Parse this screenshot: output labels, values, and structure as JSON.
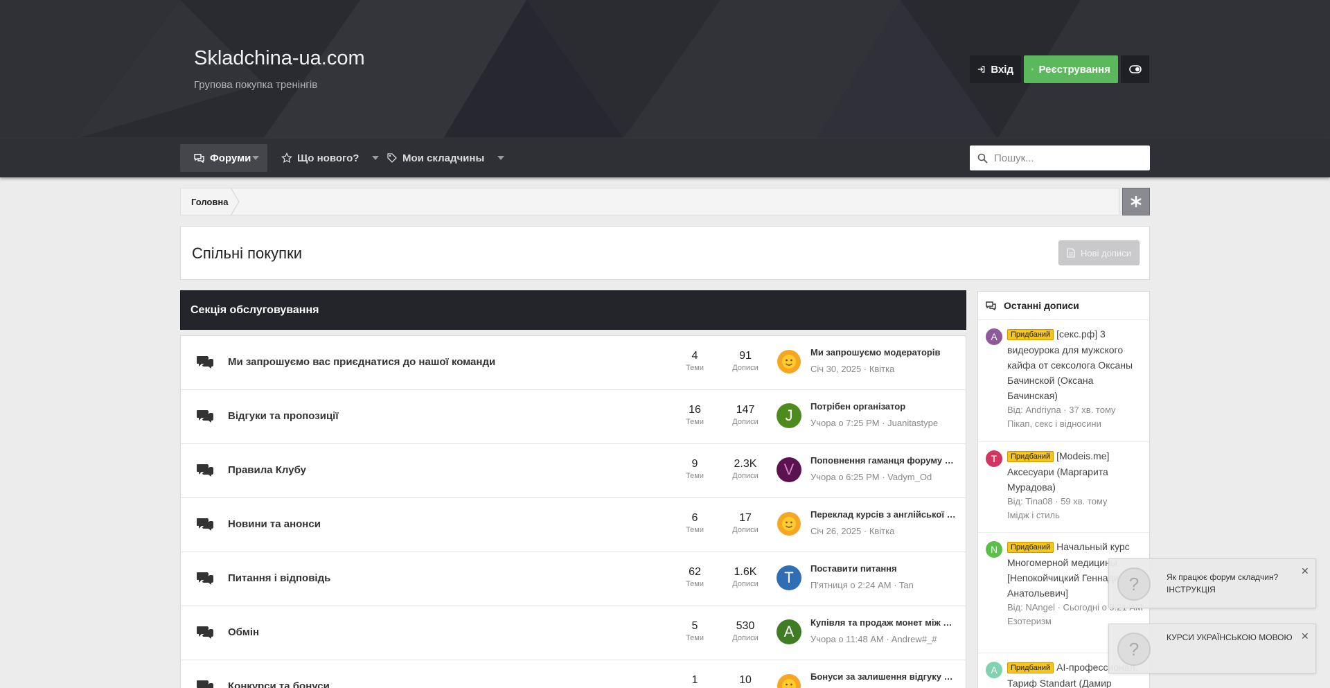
{
  "header": {
    "site_title": "Skladchina-ua.com",
    "site_subtitle": "Групова покупка тренінгів",
    "login_label": "Вхід",
    "register_label": "Реєстрування",
    "register_color": "#5cb85c"
  },
  "nav": {
    "tabs": [
      {
        "label": "Форуми",
        "icon": "comments-icon",
        "active": true
      },
      {
        "label": "Що нового?",
        "icon": "star-icon",
        "active": false
      },
      {
        "label": "Мои складчины",
        "icon": "tag-icon",
        "active": false
      }
    ],
    "search_placeholder": "Пошук..."
  },
  "breadcrumb": {
    "home": "Головна"
  },
  "page": {
    "title": "Спільні покупки",
    "new_posts_label": "Нові дописи"
  },
  "section": {
    "title": "Секція обслуговування"
  },
  "forums": [
    {
      "title": "Ми запрошуємо вас приєднатися до нашої команди",
      "threads": "4",
      "posts": "91",
      "last_title": "Ми запрошуємо модераторів",
      "last_meta": "Січ 30, 2025 · Квітка",
      "avatar": "sun",
      "avatar_letter": "",
      "avatar_color": "#f5a623"
    },
    {
      "title": "Відгуки та пропозиції",
      "threads": "16",
      "posts": "147",
      "last_title": "Потрібен організатор",
      "last_meta": "Учора о 7:25 PM · Juanitastype",
      "avatar": "letter",
      "avatar_letter": "J",
      "avatar_color": "#4f8a1f"
    },
    {
      "title": "Правила Клубу",
      "threads": "9",
      "posts": "2.3K",
      "last_title": "Поповнення гаманця форуму Складчина",
      "last_meta": "Учора о 6:25 PM · Vadym_Od",
      "avatar": "letter",
      "avatar_letter": "V",
      "avatar_color": "#5a1250"
    },
    {
      "title": "Новини та анонси",
      "threads": "6",
      "posts": "17",
      "last_title": "Переклад курсів з англійської мови",
      "last_meta": "Січ 26, 2025 · Квітка",
      "avatar": "sun",
      "avatar_letter": "",
      "avatar_color": "#f5a623"
    },
    {
      "title": "Питання і відповідь",
      "threads": "62",
      "posts": "1.6K",
      "last_title": "Поставити питання",
      "last_meta": "П'ятниця о 2:24 AM · Tan",
      "avatar": "letter",
      "avatar_letter": "T",
      "avatar_color": "#2f6db5"
    },
    {
      "title": "Обмін",
      "threads": "5",
      "posts": "530",
      "last_title": "Купівля та продаж монет між учасниками",
      "last_meta": "Учора о 11:48 AM · Andrew#_#",
      "avatar": "letter",
      "avatar_letter": "A",
      "avatar_color": "#3e7d24"
    },
    {
      "title": "Конкурси та бонуси",
      "threads": "1",
      "posts": "10",
      "last_title": "Бонуси за залишення відгуку до складчини",
      "last_meta": "",
      "avatar": "sun",
      "avatar_letter": "",
      "avatar_color": "#f5a623"
    }
  ],
  "stat_labels": {
    "threads": "Теми",
    "posts": "Дописи"
  },
  "sidebar": {
    "title": "Останні дописи",
    "badge": "Придбаний",
    "items": [
      {
        "title": "[секс.рф] 3 видеоурока для мужского кайфа от сексолога Оксаны Бачинской (Оксана Бачинская)",
        "meta": "Від: Andriyna · 37 хв. тому",
        "forum": "Пікап, секс і відносини",
        "letter": "A",
        "color": "#8e5a9b"
      },
      {
        "title": "[Modeis.me] Аксесуари (Маргарита Мурадова)",
        "meta": "Від: Tina08 · 59 хв. тому",
        "forum": "Імідж і стиль",
        "letter": "T",
        "color": "#d0365f"
      },
      {
        "title": "Начальный курс Многомерной медицины [Непокойчицкий Геннадий Анатольевич]",
        "meta": "Від: NAngel · Сьогодні о 9:21 AM",
        "forum": "Езотеризм",
        "letter": "N",
        "color": "#5cbf4a"
      },
      {
        "title": "AI-профессионал. Тариф Standart (Дамир",
        "meta": "",
        "forum": "",
        "letter": "A",
        "color": "#7fd3b1"
      }
    ]
  },
  "notices": [
    {
      "line1": "Як працює форум складчин?",
      "line2": "ІНСТРУКЦІЯ"
    },
    {
      "line1": "КУРСИ УКРАЇНСЬКОЮ МОВОЮ",
      "line2": ""
    }
  ]
}
